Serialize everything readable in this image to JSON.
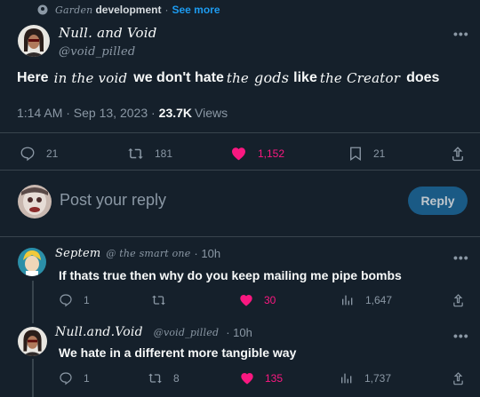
{
  "community": {
    "name_prefix": "Garden",
    "name_main": "development",
    "separator": "·",
    "see_more": "See more"
  },
  "post": {
    "display_name": "Null. and Void",
    "handle": "@void_pilled",
    "text_parts": {
      "p1": "Here",
      "p2": "in the void",
      "p3": "we don't hate",
      "p4": "the",
      "p5": "gods",
      "p6": "like",
      "p7": "the Creator",
      "p8": "does"
    },
    "time": "1:14 AM · Sep 13, 2023 ·",
    "views_count": "23.7K",
    "views_label": "Views",
    "actions": {
      "replies": "21",
      "reposts": "181",
      "likes": "1,152",
      "bookmarks": "21"
    }
  },
  "compose": {
    "placeholder": "Post your reply",
    "button": "Reply"
  },
  "replies": [
    {
      "display_name": "Septem",
      "handle": "@ the smart one",
      "time": "· 10h",
      "text": "If thats true then why do you keep mailing me pipe bombs",
      "actions": {
        "replies": "1",
        "reposts": "",
        "likes": "30",
        "views": "1,647"
      }
    },
    {
      "display_name": "Null.and.Void",
      "handle": "@void_pilled",
      "time": "· 10h",
      "text": "We hate in a different more tangible way",
      "actions": {
        "replies": "1",
        "reposts": "8",
        "likes": "135",
        "views": "1,737"
      }
    }
  ],
  "colors": {
    "background": "#15202b",
    "accent": "#1d9bf0",
    "like": "#f91880",
    "muted": "#8b98a5",
    "divider": "#38444d"
  },
  "icons": [
    "community-pin-icon",
    "more-icon",
    "reply-icon",
    "repost-icon",
    "heart-icon",
    "bookmark-icon",
    "share-icon",
    "views-icon"
  ]
}
